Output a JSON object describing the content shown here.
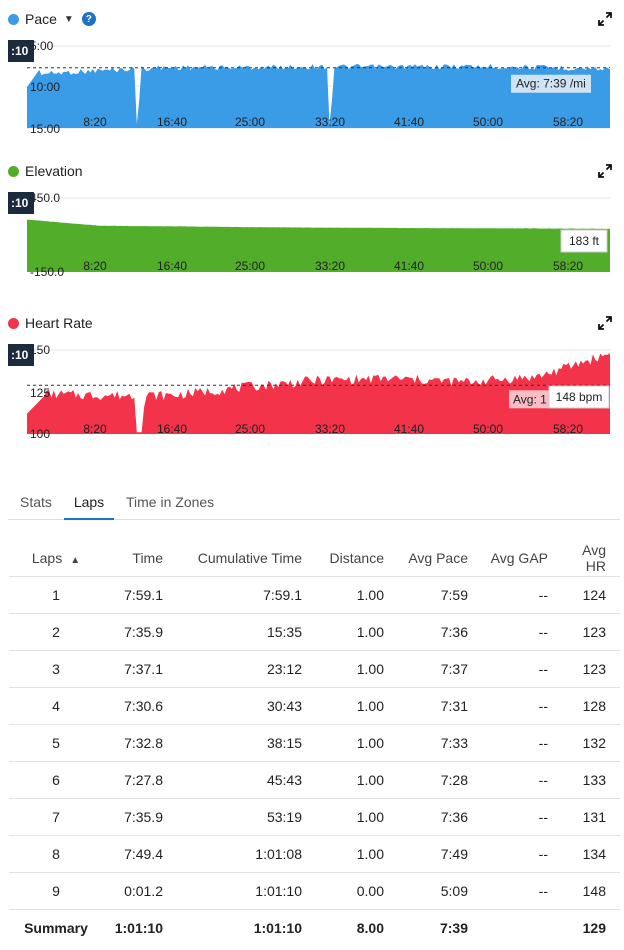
{
  "colors": {
    "pace": "#3a9be6",
    "elevation": "#52ad2b",
    "heart_rate": "#f2334a",
    "accent": "#1a73c9",
    "time_badge": "#1b2a3c"
  },
  "x_ticks": [
    "8:20",
    "16:40",
    "25:00",
    "33:20",
    "41:40",
    "50:00",
    "58:20"
  ],
  "time_badge": ":10",
  "pace": {
    "title": "Pace",
    "dropdown_icon": "caret-down",
    "help_icon": "question-circle",
    "help_glyph": "?",
    "y_ticks": [
      "5:00",
      "10:00",
      "15:00"
    ],
    "avg_label": "Avg: 7:39 /mi",
    "chart_data": {
      "type": "area",
      "title": "Pace",
      "y_unit": "min/mi",
      "ylim": [
        "5:00",
        "15:00"
      ],
      "avg": "7:39",
      "x": [
        "0:00",
        "8:20",
        "16:40",
        "25:00",
        "33:20",
        "41:40",
        "50:00",
        "58:20",
        "1:01:10"
      ],
      "values": [
        "8:30",
        "7:59",
        "7:36",
        "7:37",
        "7:31",
        "7:33",
        "7:28",
        "7:36",
        "7:49"
      ]
    }
  },
  "elevation": {
    "title": "Elevation",
    "y_ticks": [
      "450.0",
      "-150.0"
    ],
    "value_label": "183 ft",
    "chart_data": {
      "type": "area",
      "title": "Elevation",
      "y_unit": "ft",
      "ylim": [
        -150,
        450
      ],
      "x": [
        "0:00",
        "8:20",
        "16:40",
        "25:00",
        "33:20",
        "41:40",
        "50:00",
        "58:20",
        "1:01:10"
      ],
      "values": [
        275,
        225,
        220,
        214,
        210,
        207,
        205,
        203,
        183
      ]
    }
  },
  "heart_rate": {
    "title": "Heart Rate",
    "y_ticks": [
      "150",
      "125",
      "100"
    ],
    "avg_label": "Avg: 1",
    "value_label": "148 bpm",
    "chart_data": {
      "type": "area",
      "title": "Heart Rate",
      "y_unit": "bpm",
      "ylim": [
        100,
        150
      ],
      "avg": 129,
      "x": [
        "0:00",
        "8:20",
        "16:40",
        "25:00",
        "33:20",
        "41:40",
        "50:00",
        "58:20",
        "1:01:10"
      ],
      "values": [
        124,
        123,
        123,
        128,
        132,
        133,
        131,
        134,
        148
      ]
    }
  },
  "tabs": [
    "Stats",
    "Laps",
    "Time in Zones"
  ],
  "active_tab": "Laps",
  "laps_table": {
    "headers": [
      "Laps",
      "Time",
      "Cumulative Time",
      "Distance",
      "Avg Pace",
      "Avg GAP",
      "Avg HR"
    ],
    "sort_icon": "▲",
    "rows": [
      [
        "1",
        "7:59.1",
        "7:59.1",
        "1.00",
        "7:59",
        "--",
        "124"
      ],
      [
        "2",
        "7:35.9",
        "15:35",
        "1.00",
        "7:36",
        "--",
        "123"
      ],
      [
        "3",
        "7:37.1",
        "23:12",
        "1.00",
        "7:37",
        "--",
        "123"
      ],
      [
        "4",
        "7:30.6",
        "30:43",
        "1.00",
        "7:31",
        "--",
        "128"
      ],
      [
        "5",
        "7:32.8",
        "38:15",
        "1.00",
        "7:33",
        "--",
        "132"
      ],
      [
        "6",
        "7:27.8",
        "45:43",
        "1.00",
        "7:28",
        "--",
        "133"
      ],
      [
        "7",
        "7:35.9",
        "53:19",
        "1.00",
        "7:36",
        "--",
        "131"
      ],
      [
        "8",
        "7:49.4",
        "1:01:08",
        "1.00",
        "7:49",
        "--",
        "134"
      ],
      [
        "9",
        "0:01.2",
        "1:01:10",
        "0.00",
        "5:09",
        "--",
        "148"
      ]
    ],
    "summary": [
      "Summary",
      "1:01:10",
      "1:01:10",
      "8.00",
      "7:39",
      "",
      "129"
    ]
  }
}
